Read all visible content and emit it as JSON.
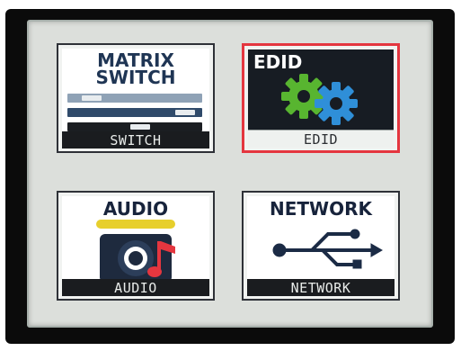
{
  "menu": {
    "tiles": [
      {
        "id": "switch",
        "art_title_line1": "MATRIX",
        "art_title_line2": "SWITCH",
        "label": "SWITCH",
        "selected": false
      },
      {
        "id": "edid",
        "art_title_line1": "EDID",
        "label": "EDID",
        "selected": true
      },
      {
        "id": "audio",
        "art_title_line1": "AUDIO",
        "label": "AUDIO",
        "selected": false
      },
      {
        "id": "network",
        "art_title_line1": "NETWORK",
        "label": "NETWORK",
        "selected": false
      }
    ]
  },
  "colors": {
    "selection_border": "#e4363f",
    "label_bar": "#1a1c1f",
    "title_blue": "#1f3554",
    "gear_green": "#58b530",
    "gear_blue": "#2f8fd8",
    "audio_yellow": "#e7cf2c",
    "audio_red": "#e4363f"
  },
  "icons": {
    "switch": "slider-bars-icon",
    "edid": "gears-icon",
    "audio": "speaker-music-note-icon",
    "network": "usb-trident-icon"
  }
}
